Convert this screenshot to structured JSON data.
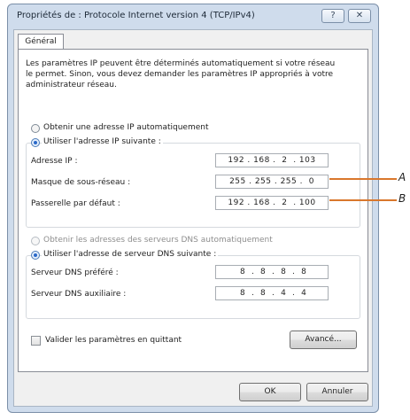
{
  "window": {
    "title": "Propriétés de : Protocole Internet version 4 (TCP/IPv4)",
    "help_button": "?",
    "close_button": "✕"
  },
  "tabs": [
    {
      "label": "Général"
    }
  ],
  "description": "Les paramètres IP peuvent être déterminés automatiquement si votre réseau le permet. Sinon, vous devez demander les paramètres IP appropriés à votre administrateur réseau.",
  "ip_section": {
    "auto_label": "Obtenir une adresse IP automatiquement",
    "manual_label": "Utiliser l'adresse IP suivante :",
    "fields": [
      {
        "label": "Adresse IP :",
        "value": "192 . 168 .  2  . 103"
      },
      {
        "label": "Masque de sous-réseau :",
        "value": "255 . 255 . 255 .  0"
      },
      {
        "label": "Passerelle par défaut :",
        "value": "192 . 168 .  2  . 100"
      }
    ]
  },
  "dns_section": {
    "auto_label": "Obtenir les adresses des serveurs DNS automatiquement",
    "manual_label": "Utiliser l'adresse de serveur DNS suivante :",
    "fields": [
      {
        "label": "Serveur DNS préféré :",
        "value": " 8  .  8  .  8  .  8"
      },
      {
        "label": "Serveur DNS auxiliaire :",
        "value": " 8  .  8  .  4  .  4"
      }
    ]
  },
  "validate_label": "Valider les paramètres en quittant",
  "buttons": {
    "advanced": "Avancé...",
    "ok": "OK",
    "cancel": "Annuler"
  },
  "annotations": {
    "a": "A",
    "b": "B"
  },
  "colors": {
    "accent": "#d9772c",
    "title_bar": "#cfdcec"
  }
}
